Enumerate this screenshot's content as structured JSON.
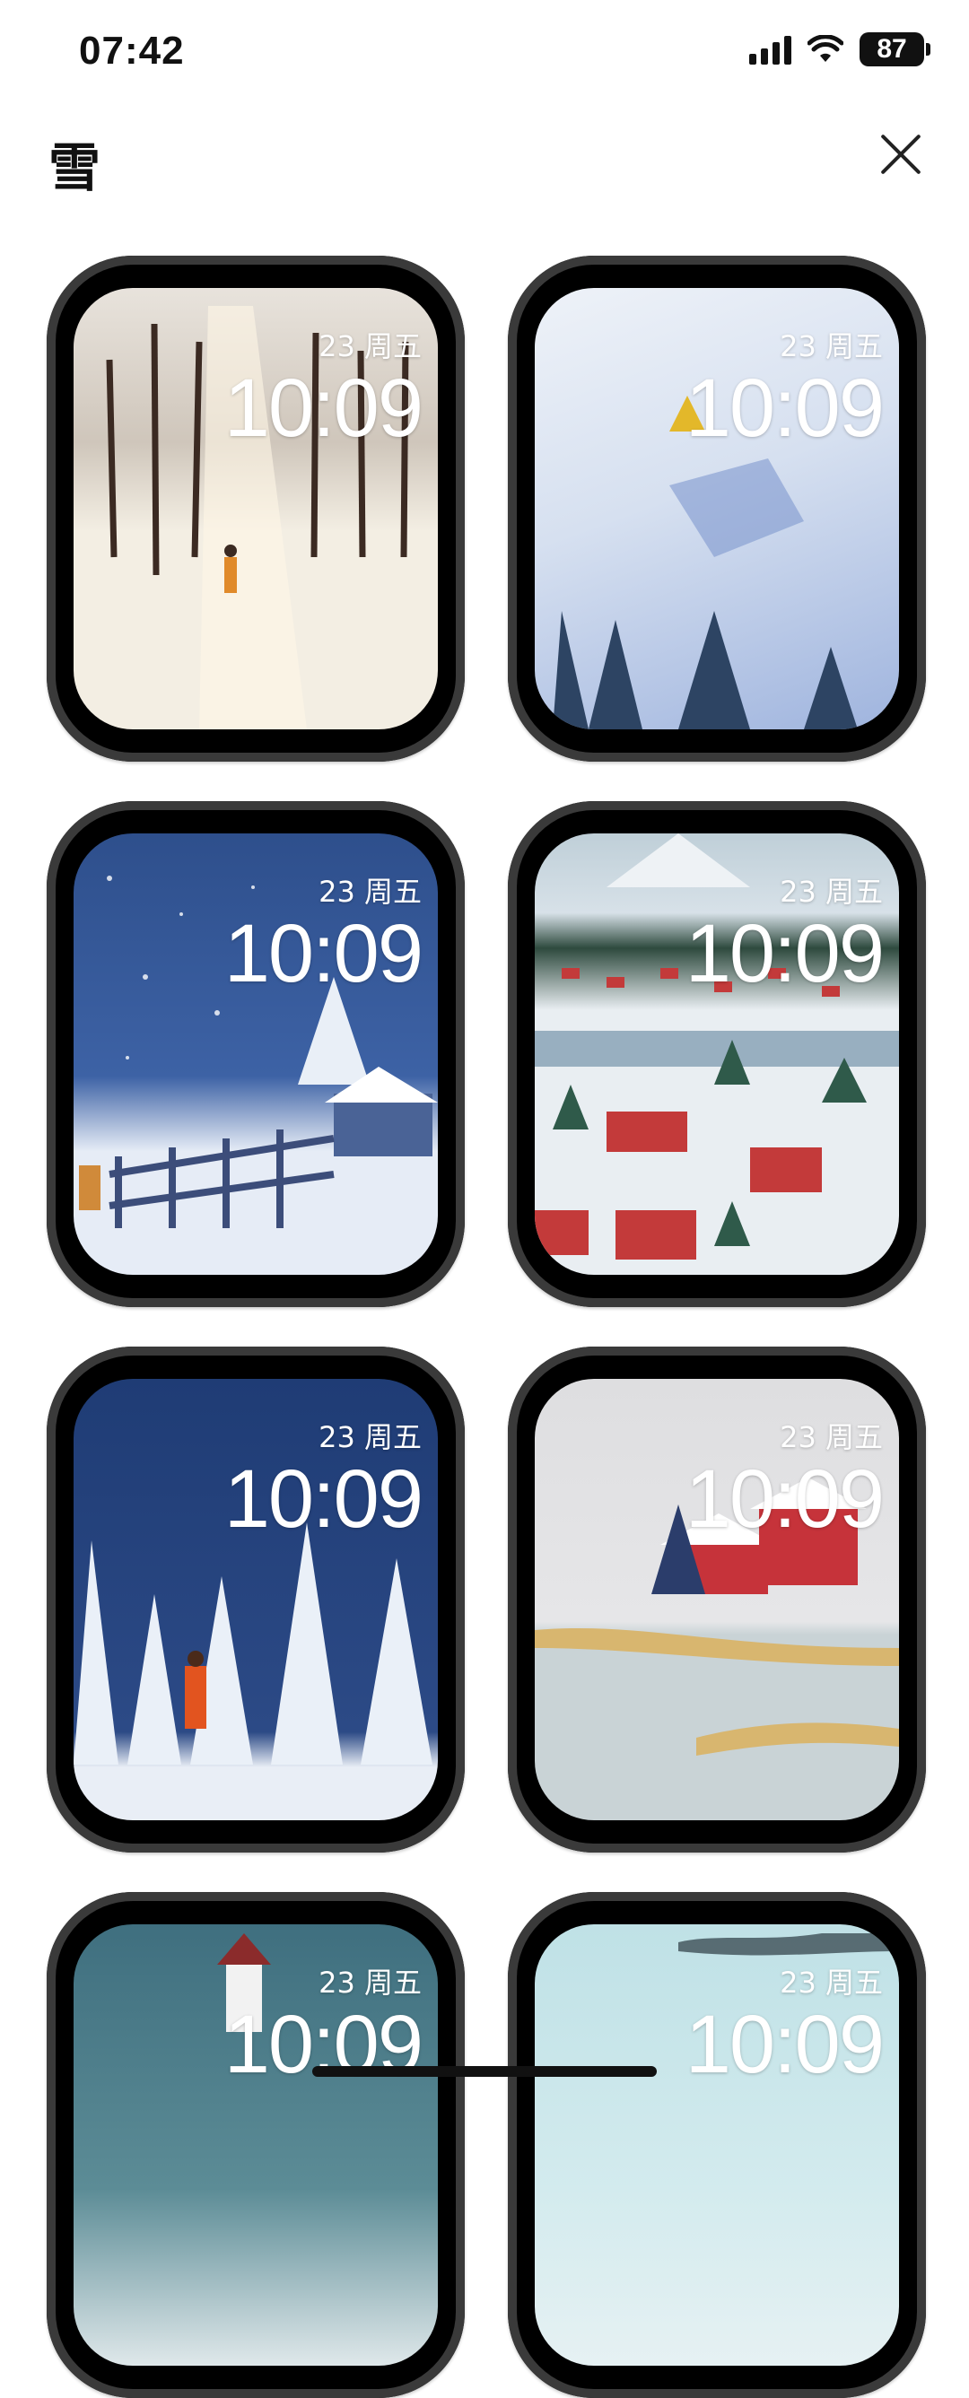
{
  "status_bar": {
    "time": "07:42",
    "battery": "87"
  },
  "header": {
    "title": "雪"
  },
  "overlay": {
    "date": "23 周五",
    "time": "10:09"
  },
  "watch_faces": [
    {
      "colors": {
        "sky": "#d8d3cc",
        "ground": "#f3eee3",
        "accent": "#e08a2a"
      },
      "icons": "trees-snow-walker"
    },
    {
      "colors": {
        "sky": "#dfe6f2",
        "ground": "#c8d6ee",
        "accent": "#e3b82a"
      },
      "icons": "slope-tent-pines"
    },
    {
      "colors": {
        "sky": "#3a5a9a",
        "ground": "#e6ecf6",
        "accent": "#d08a3a"
      },
      "icons": "night-fence-cabin"
    },
    {
      "colors": {
        "sky": "#c9d6de",
        "ground": "#e9eef2",
        "accent": "#c33a3a"
      },
      "icons": "village-red-houses"
    },
    {
      "colors": {
        "sky": "#213f7a",
        "ground": "#2c4a86",
        "accent": "#e2541f"
      },
      "icons": "forest-night-person"
    },
    {
      "colors": {
        "sky": "#dedee0",
        "ground": "#f2f2f2",
        "accent": "#c6333a"
      },
      "icons": "lake-red-barn"
    },
    {
      "colors": {
        "sky": "#3f6f7f",
        "ground": "#dfe8ea",
        "accent": "#f2f2f2"
      },
      "icons": "house-teal"
    },
    {
      "colors": {
        "sky": "#bfe1e6",
        "ground": "#e6f1f3",
        "accent": "#2b3a42"
      },
      "icons": "ice-light"
    }
  ]
}
